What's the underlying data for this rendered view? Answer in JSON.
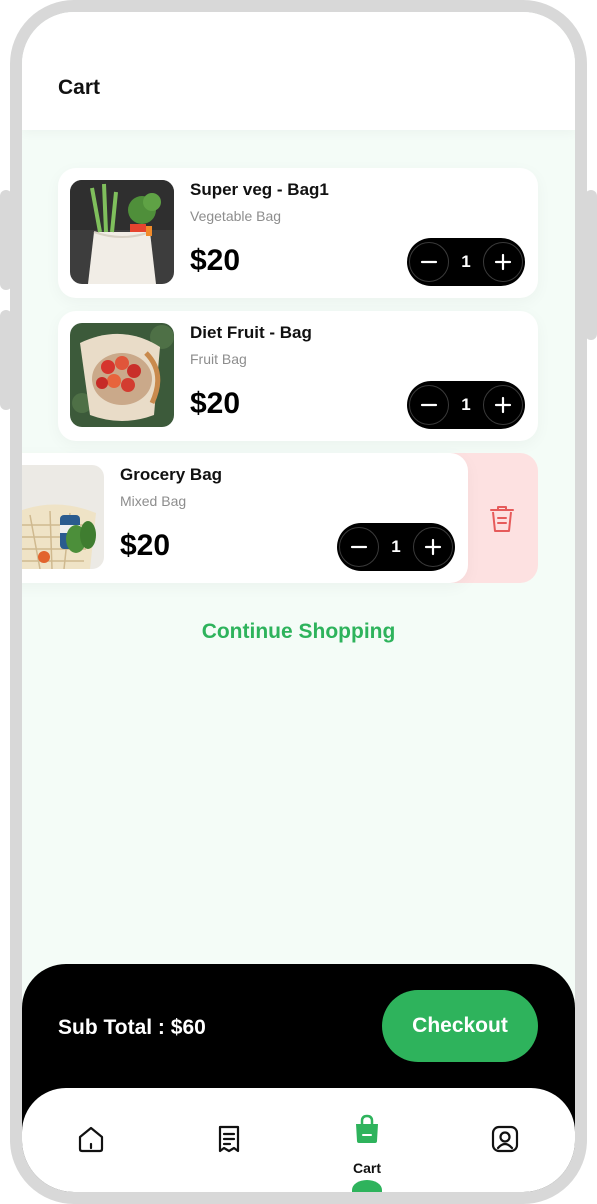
{
  "header": {
    "title": "Cart"
  },
  "items": [
    {
      "name": "Super veg - Bag1",
      "subtitle": "Vegetable Bag",
      "price": "$20",
      "quantity": "1",
      "image": "vegetable-bag-photo"
    },
    {
      "name": "Diet Fruit - Bag",
      "subtitle": "Fruit Bag",
      "price": "$20",
      "quantity": "1",
      "image": "fruit-bag-photo"
    },
    {
      "name": "Grocery Bag",
      "subtitle": "Mixed Bag",
      "price": "$20",
      "quantity": "1",
      "image": "grocery-bag-photo"
    }
  ],
  "continue_label": "Continue Shopping",
  "checkout": {
    "subtotal": "Sub Total : $60",
    "button_label": "Checkout"
  },
  "nav": {
    "items": [
      {
        "icon": "home-icon",
        "label": ""
      },
      {
        "icon": "receipt-icon",
        "label": ""
      },
      {
        "icon": "shopping-bag-icon",
        "label": "Cart",
        "active": true
      },
      {
        "icon": "profile-icon",
        "label": ""
      }
    ]
  },
  "colors": {
    "accent": "#2eb35c",
    "background": "#f4fcf7",
    "delete_bg": "#fde1e1",
    "delete_icon": "#e65b5b",
    "dark": "#000000"
  }
}
